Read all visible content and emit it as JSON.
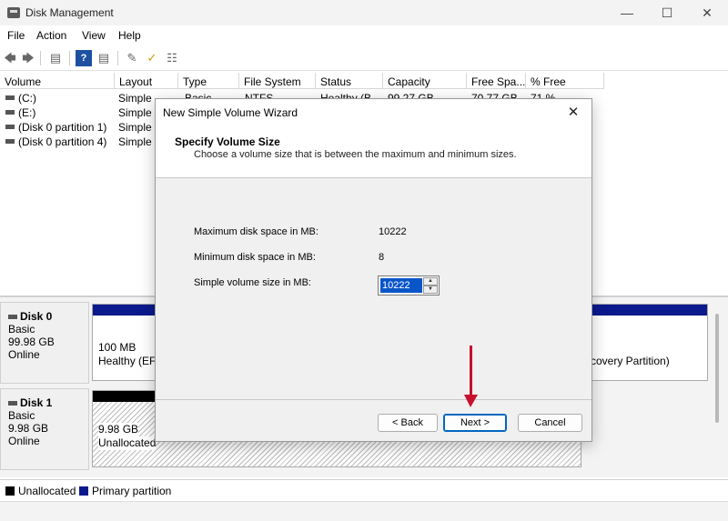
{
  "window": {
    "title": "Disk Management"
  },
  "menu": [
    "File",
    "Action",
    "View",
    "Help"
  ],
  "toolbar_icons": [
    "back-arrow",
    "forward-arrow",
    "console-tree",
    "help",
    "properties",
    "connect",
    "check",
    "list-view"
  ],
  "columns": [
    "Volume",
    "Layout",
    "Type",
    "File System",
    "Status",
    "Capacity",
    "Free Spa...",
    "% Free"
  ],
  "first_row_partial": {
    "type": "Basic",
    "file_system": "NTFS",
    "status": "Healthy (B...",
    "capacity": "99.27 GB",
    "free": "70.77 GB",
    "pct": "71 %"
  },
  "volumes": [
    {
      "name": "(C:)",
      "layout": "Simple"
    },
    {
      "name": "(E:)",
      "layout": "Simple"
    },
    {
      "name": "(Disk 0 partition 1)",
      "layout": "Simple"
    },
    {
      "name": "(Disk 0 partition 4)",
      "layout": "Simple"
    }
  ],
  "disks": [
    {
      "name": "Disk 0",
      "type": "Basic",
      "size": "99.98 GB",
      "status": "Online",
      "left_part": {
        "size": "100 MB",
        "status": "Healthy (EFI"
      },
      "right_part": {
        "status": "covery Partition)"
      }
    },
    {
      "name": "Disk 1",
      "type": "Basic",
      "size": "9.98 GB",
      "status": "Online",
      "left_part": {
        "size": "9.98 GB",
        "status": "Unallocated"
      }
    }
  ],
  "legend": [
    {
      "label": "Unallocated",
      "color": "#000000"
    },
    {
      "label": "Primary partition",
      "color": "#0a1a8c"
    }
  ],
  "dialog": {
    "title": "New Simple Volume Wizard",
    "heading": "Specify Volume Size",
    "subheading": "Choose a volume size that is between the maximum and minimum sizes.",
    "max_label": "Maximum disk space in MB:",
    "max_value": "10222",
    "min_label": "Minimum disk space in MB:",
    "min_value": "8",
    "size_label": "Simple volume size in MB:",
    "size_value": "10222",
    "back_label": "< Back",
    "next_label": "Next >",
    "cancel_label": "Cancel"
  },
  "colors": {
    "accent": "#0067c0",
    "primary_partition": "#0a1a8c",
    "annotation_arrow": "#c8102e"
  }
}
